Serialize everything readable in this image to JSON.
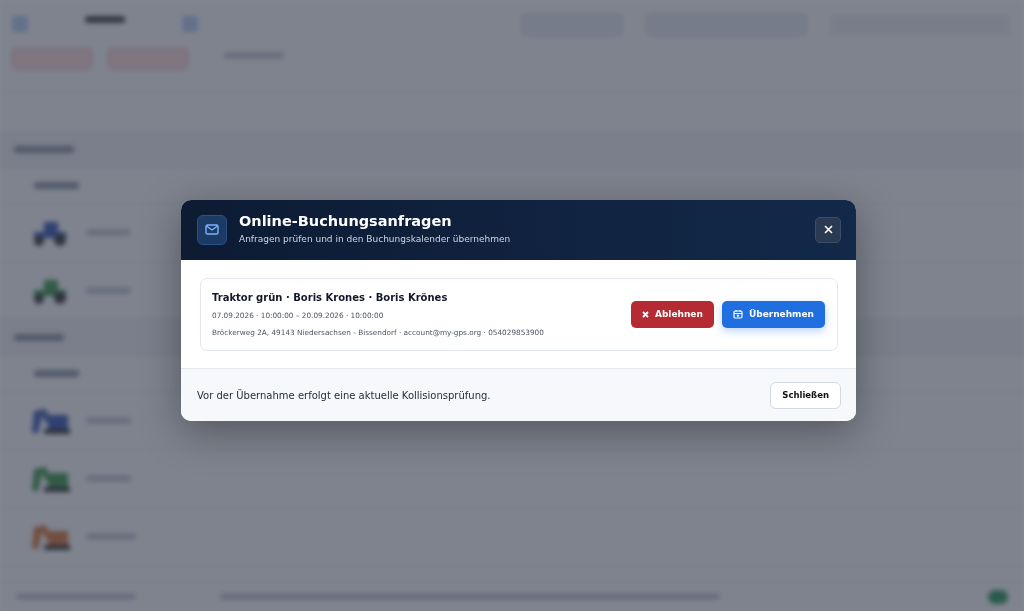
{
  "modal": {
    "title": "Online-Buchungsanfragen",
    "subtitle": "Anfragen prüfen und in den Buchungskalender übernehmen",
    "requests": [
      {
        "title": "Traktor grün · Boris Krones · Boris Krönes",
        "dates": "07.09.2026 · 10:00:00 – 20.09.2026 · 10:00:00",
        "contact": "Bröckerweg 2A, 49143 Niedersachsen - Bissendorf · account@my-gps.org · 054029853900",
        "actions": [
          {
            "kind": "reject",
            "label": "Ablehnen"
          },
          {
            "kind": "accept",
            "label": "Übernehmen"
          }
        ]
      }
    ],
    "footer_note": "Vor der Übernahme erfolgt eine aktuelle Kollisionsprüfung.",
    "close_label": "Schließen"
  }
}
